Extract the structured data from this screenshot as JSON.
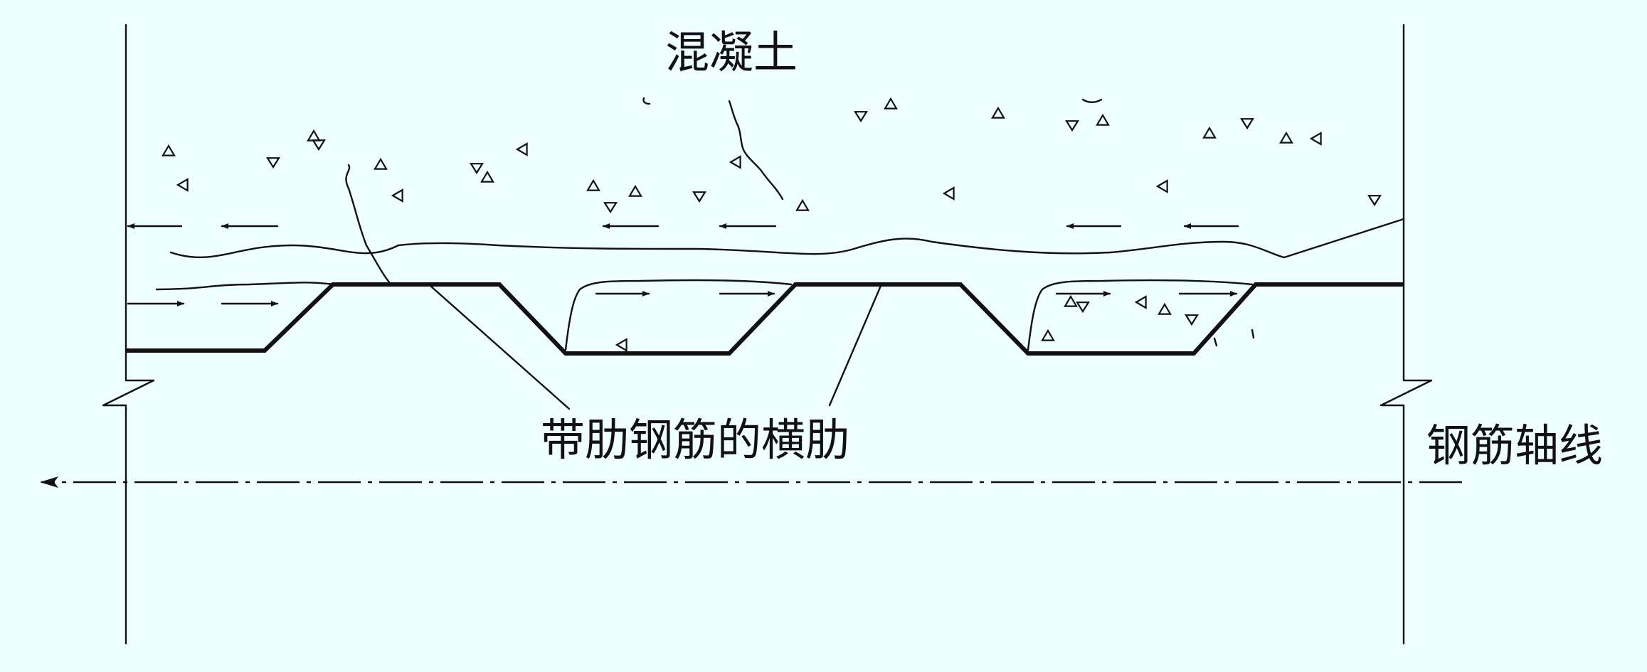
{
  "labels": {
    "concrete": "混凝土",
    "transverse_rib": "带肋钢筋的横肋",
    "rebar_axis": "钢筋轴线"
  },
  "colors": {
    "background": "#effeff",
    "line": "#111111"
  }
}
